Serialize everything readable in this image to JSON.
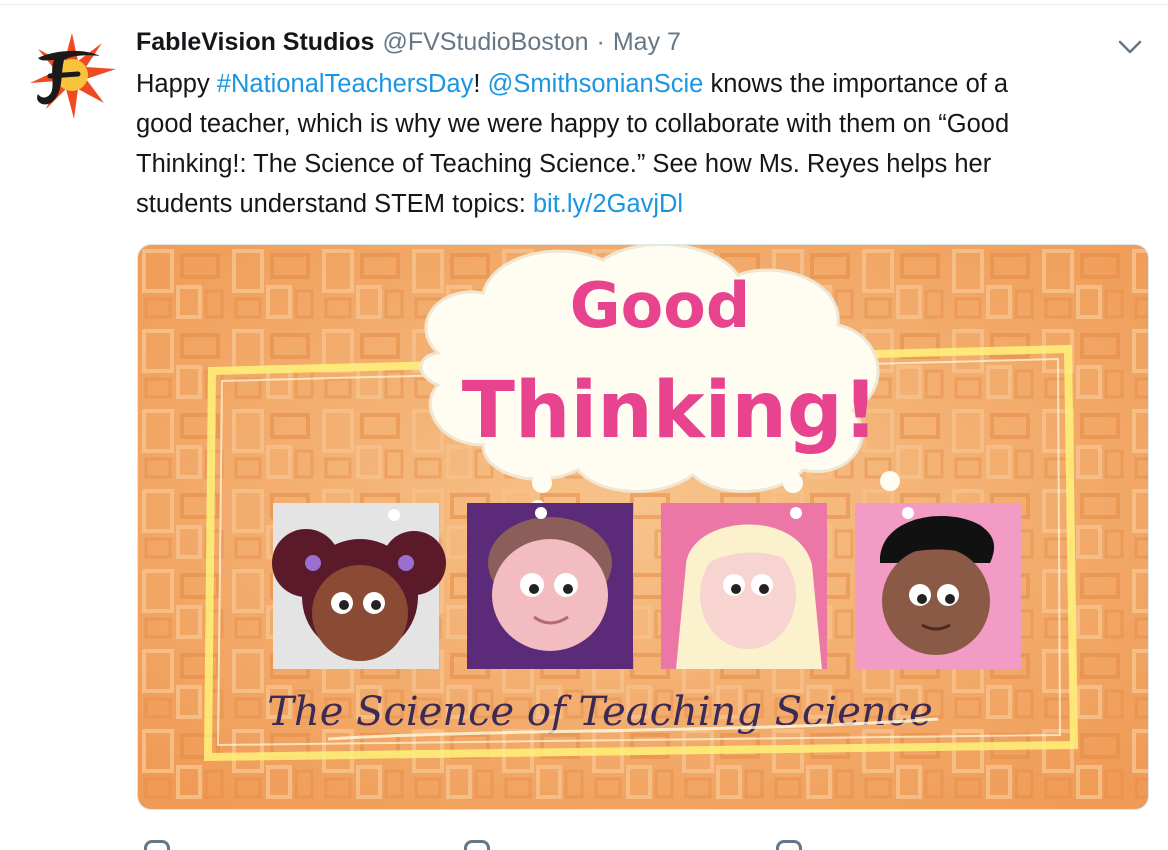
{
  "tweet": {
    "author_name": "FableVision Studios",
    "author_handle": "@FVStudioBoston",
    "separator": "·",
    "date": "May 7",
    "text_parts": {
      "p1": "Happy ",
      "hashtag": "#NationalTeachersDay",
      "p2": "! ",
      "mention": "@SmithsonianScie",
      "p3": " knows the importance of a",
      "line2": "good teacher, which is why we were happy to collaborate with them on “Good",
      "line3": "Thinking!: The Science of Teaching Science.” See how Ms. Reyes helps her",
      "line4a": "students understand STEM topics: ",
      "url": "bit.ly/2GavjDl"
    }
  },
  "media": {
    "title_line1": "Good",
    "title_line2": "Thinking!",
    "subtitle": "The Science of Teaching Science"
  },
  "colors": {
    "link": "#1b95e0",
    "title_pink": "#e8438e",
    "background_orange": "#f3a767",
    "frame_yellow": "#fff27a"
  },
  "icons": {
    "avatar": "fablevision-logo-icon",
    "menu": "chevron-down-icon",
    "actions": [
      "reply-icon",
      "retweet-icon",
      "like-icon",
      "share-icon"
    ]
  }
}
